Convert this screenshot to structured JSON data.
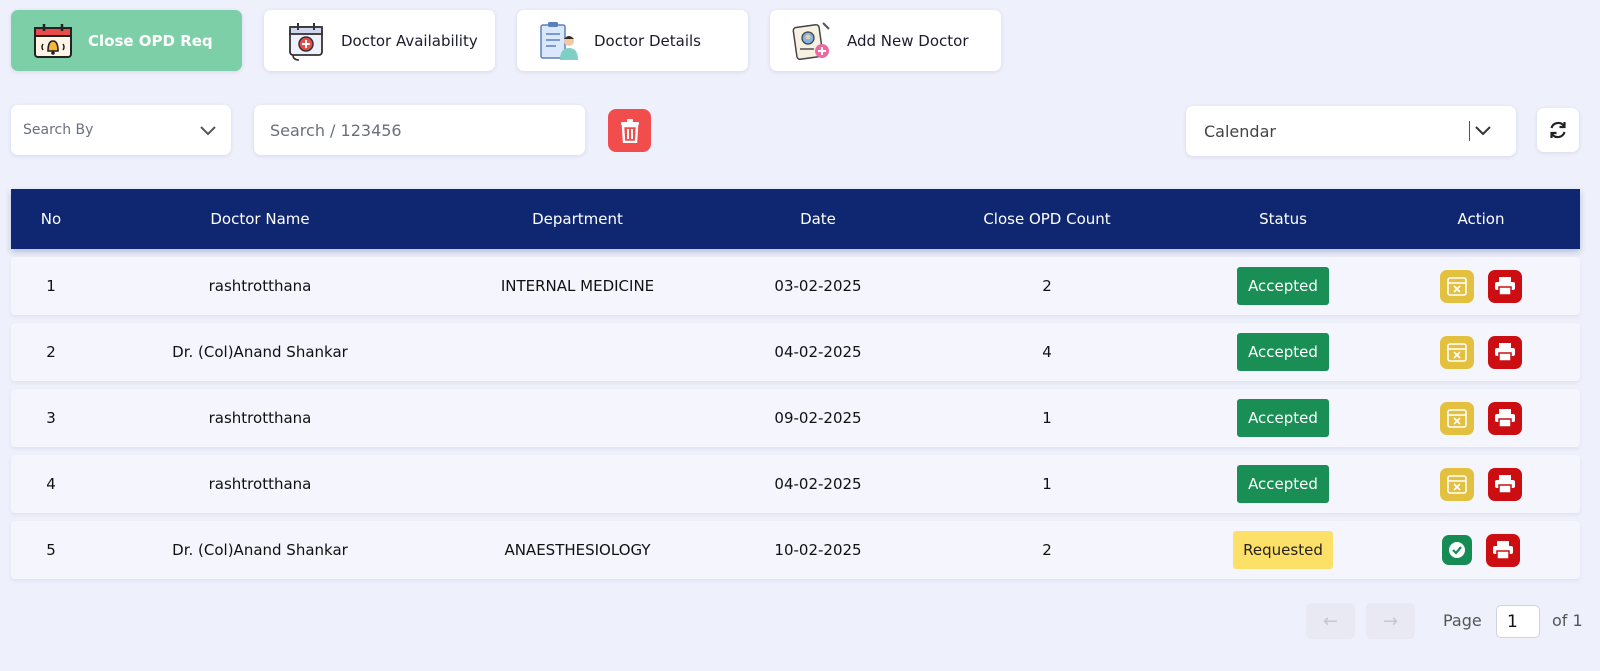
{
  "tabs": [
    {
      "label": "Close OPD Req",
      "icon": "calendar-bell-icon",
      "active": true
    },
    {
      "label": "Doctor Availability",
      "icon": "calendar-stethoscope-icon",
      "active": false
    },
    {
      "label": "Doctor Details",
      "icon": "doctor-clipboard-icon",
      "active": false
    },
    {
      "label": "Add New Doctor",
      "icon": "add-doctor-icon",
      "active": false
    }
  ],
  "filters": {
    "search_by_label": "Search By",
    "search_placeholder": "Search / 123456",
    "calendar_label": "Calendar"
  },
  "table": {
    "headers": [
      "No",
      "Doctor Name",
      "Department",
      "Date",
      "Close OPD Count",
      "Status",
      "Action"
    ],
    "rows": [
      {
        "no": "1",
        "doctor": "rashtrotthana",
        "department": "INTERNAL MEDICINE",
        "date": "03-02-2025",
        "count": "2",
        "status": "Accepted"
      },
      {
        "no": "2",
        "doctor": "Dr. (Col)Anand Shankar",
        "department": "",
        "date": "04-02-2025",
        "count": "4",
        "status": "Accepted"
      },
      {
        "no": "3",
        "doctor": "rashtrotthana",
        "department": "",
        "date": "09-02-2025",
        "count": "1",
        "status": "Accepted"
      },
      {
        "no": "4",
        "doctor": "rashtrotthana",
        "department": "",
        "date": "04-02-2025",
        "count": "1",
        "status": "Accepted"
      },
      {
        "no": "5",
        "doctor": "Dr. (Col)Anand Shankar",
        "department": "ANAESTHESIOLOGY",
        "date": "10-02-2025",
        "count": "2",
        "status": "Requested"
      }
    ]
  },
  "pagination": {
    "prev_label": "←",
    "next_label": "→",
    "page_label": "Page",
    "current_page": "1",
    "of_label": "of 1"
  },
  "colors": {
    "header_bg": "#0f2770",
    "active_tab": "#7ccfa6",
    "accepted": "#1a8f55",
    "requested": "#fde067",
    "delete": "#f14d4d",
    "print": "#cc0e12",
    "cancel": "#e3c03d"
  }
}
